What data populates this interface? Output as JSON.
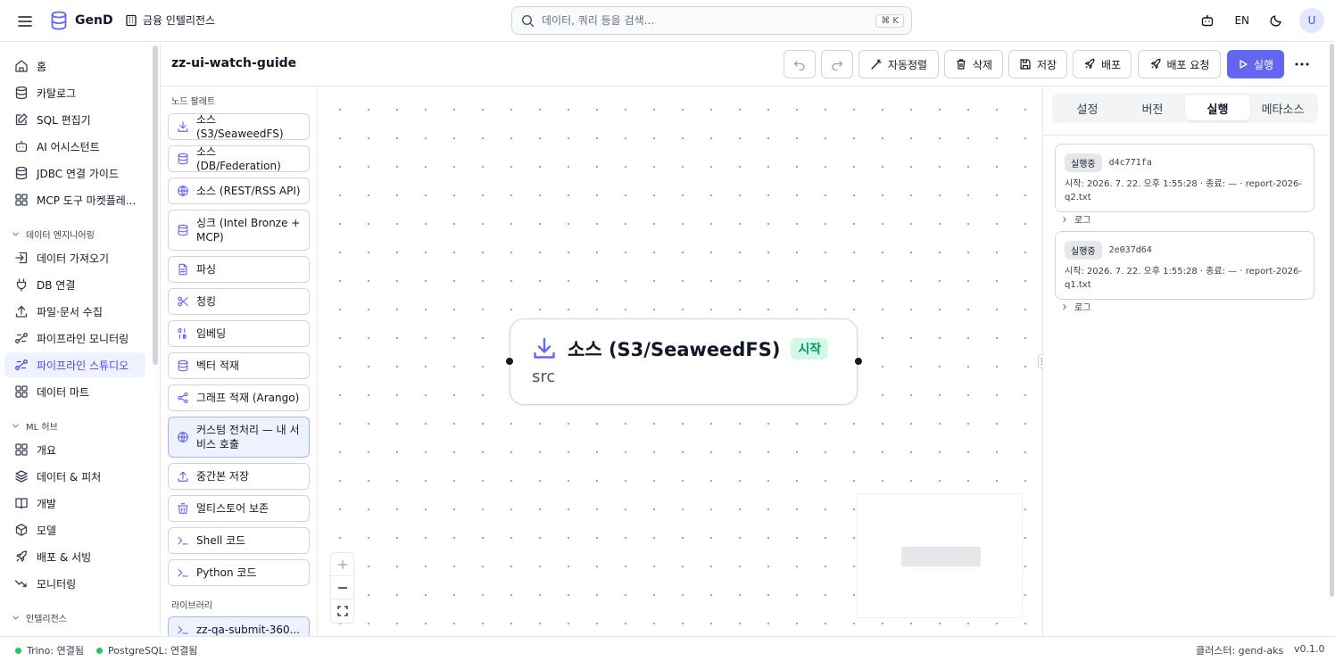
{
  "app": {
    "name": "GenD",
    "workspace": "금융 인텔리전스"
  },
  "search": {
    "placeholder": "데이터, 쿼리 등을 검색...",
    "shortcut": "⌘ K"
  },
  "topbar": {
    "language": "EN",
    "avatar_initial": "U"
  },
  "nav": {
    "items_top": [
      {
        "label": "홈",
        "icon": "home-icon"
      },
      {
        "label": "카탈로그",
        "icon": "database-icon"
      },
      {
        "label": "SQL 편집기",
        "icon": "edit-icon"
      },
      {
        "label": "AI 어시스턴트",
        "icon": "robot-icon"
      },
      {
        "label": "JDBC 연결 가이드",
        "icon": "database-icon"
      },
      {
        "label": "MCP 도구 마켓플레...",
        "icon": "grid-icon"
      }
    ],
    "section_data_eng": "데이터 엔지니어링",
    "items_data_eng": [
      {
        "label": "데이터 가져오기",
        "icon": "import-icon"
      },
      {
        "label": "DB 연결",
        "icon": "plug-icon"
      },
      {
        "label": "파일·문서 수집",
        "icon": "upload-icon"
      },
      {
        "label": "파이프라인 모니터링",
        "icon": "workflow-icon"
      },
      {
        "label": "파이프라인 스튜디오",
        "icon": "workflow-icon"
      },
      {
        "label": "데이터 마트",
        "icon": "grid-icon"
      }
    ],
    "section_ml": "ML 허브",
    "items_ml": [
      {
        "label": "개요",
        "icon": "grid-icon"
      },
      {
        "label": "데이터 & 피처",
        "icon": "layers-icon"
      },
      {
        "label": "개발",
        "icon": "book-icon"
      },
      {
        "label": "모델",
        "icon": "box-icon"
      },
      {
        "label": "배포 & 서빙",
        "icon": "rocket-icon"
      },
      {
        "label": "모니터링",
        "icon": "trend-icon"
      }
    ],
    "section_intel": "인텔리전스"
  },
  "header": {
    "title": "zz-ui-watch-guide",
    "auto_layout": "자동정렬",
    "delete": "삭제",
    "save": "저장",
    "deploy": "배포",
    "deploy_request": "배포 요청",
    "run": "실행"
  },
  "palette": {
    "section_nodes": "노드 팔레트",
    "items": [
      {
        "label": "소스 (S3/SeaweedFS)",
        "icon": "download-icon"
      },
      {
        "label": "소스 (DB/Federation)",
        "icon": "database-icon"
      },
      {
        "label": "소스 (REST/RSS API)",
        "icon": "globe-icon"
      },
      {
        "label": "싱크 (Intel Bronze + MCP)",
        "icon": "database-icon"
      },
      {
        "label": "파싱",
        "icon": "file-icon"
      },
      {
        "label": "청킹",
        "icon": "scissors-icon"
      },
      {
        "label": "임베딩",
        "icon": "binary-icon"
      },
      {
        "label": "벡터 적재",
        "icon": "database-icon"
      },
      {
        "label": "그래프 적재 (Arango)",
        "icon": "share-icon"
      },
      {
        "label": "커스텀 전처리 — 내 서비스 호출",
        "icon": "globe-icon"
      },
      {
        "label": "중간본 저장",
        "icon": "upload-icon"
      },
      {
        "label": "멀티스토어 보존",
        "icon": "archive-icon"
      },
      {
        "label": "Shell 코드",
        "icon": "terminal-icon"
      },
      {
        "label": "Python 코드",
        "icon": "terminal-icon"
      }
    ],
    "section_library": "라이브러리",
    "library_items": [
      {
        "label": "zz-qa-submit-360...",
        "icon": "terminal-icon"
      }
    ]
  },
  "canvas": {
    "node": {
      "title": "소스 (S3/SeaweedFS)",
      "badge": "시작",
      "subtitle": "src"
    }
  },
  "right_panel": {
    "tabs": [
      "설정",
      "버전",
      "실행",
      "메타소스"
    ],
    "active_tab": "실행",
    "runs": [
      {
        "status": "실행중",
        "id": "d4c771fa",
        "meta": "시작: 2026. 7. 22. 오후 1:55:28 · 종료: — · report-2026-q2.txt",
        "log_label": "로그"
      },
      {
        "status": "실행중",
        "id": "2e037d64",
        "meta": "시작: 2026. 7. 22. 오후 1:55:28 · 종료: — · report-2026-q1.txt",
        "log_label": "로그"
      }
    ]
  },
  "status_bar": {
    "trino": "Trino: 연결됨",
    "postgres": "PostgreSQL: 연결됨",
    "cluster": "클러스터: gend-aks",
    "version": "v0.1.0"
  },
  "colors": {
    "accent": "#6366f1",
    "active_bg": "#eef2ff",
    "badge_green": "#059669",
    "status_ok": "#22c55e"
  }
}
